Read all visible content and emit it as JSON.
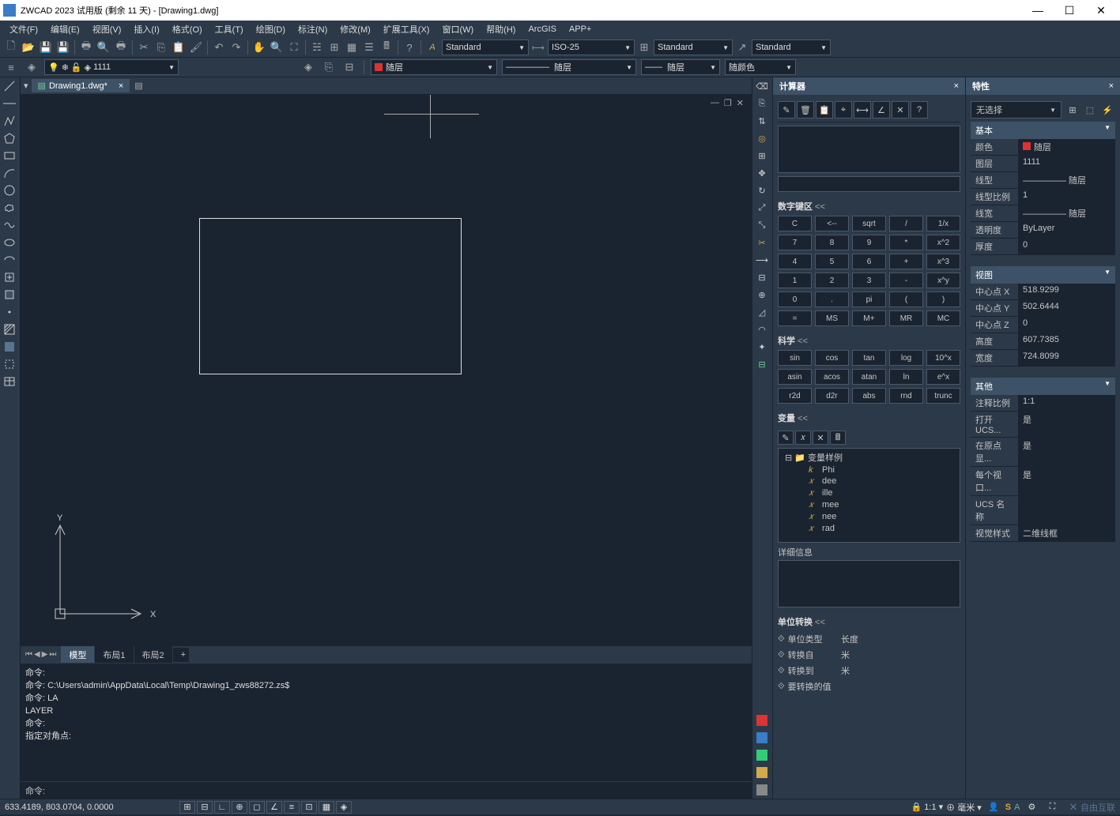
{
  "window": {
    "title": "ZWCAD 2023 试用版 (剩余 11 天) - [Drawing1.dwg]"
  },
  "menu": [
    "文件(F)",
    "编辑(E)",
    "视图(V)",
    "插入(I)",
    "格式(O)",
    "工具(T)",
    "绘图(D)",
    "标注(N)",
    "修改(M)",
    "扩展工具(X)",
    "窗口(W)",
    "帮助(H)",
    "ArcGIS",
    "APP+"
  ],
  "toolbar1": {
    "text_style": "Standard",
    "dim_style": "ISO-25",
    "table_style": "Standard",
    "mleader_style": "Standard",
    "layer_name": "1111"
  },
  "toolbar2": {
    "layer": "随层",
    "linetype": "随层",
    "lineweight": "随层",
    "color": "随颜色"
  },
  "doc_tab": "Drawing1.dwg*",
  "model_tabs": [
    "模型",
    "布局1",
    "布局2"
  ],
  "cmd_history": [
    "命令:",
    "命令: C:\\Users\\admin\\AppData\\Local\\Temp\\Drawing1_zws88272.zs$",
    "命令: LA",
    "LAYER",
    "命令:",
    "指定对角点:"
  ],
  "cmd_prompt": "命令:",
  "status": {
    "coords": "633.4189, 803.0704, 0.0000",
    "scale": "1:1",
    "unit": "毫米",
    "watermark": "自由互联"
  },
  "calc": {
    "title": "计算器",
    "numpad_h": "数字键区",
    "numpad": [
      [
        "C",
        "<--",
        "sqrt",
        "/",
        "1/x"
      ],
      [
        "7",
        "8",
        "9",
        "*",
        "x^2"
      ],
      [
        "4",
        "5",
        "6",
        "+",
        "x^3"
      ],
      [
        "1",
        "2",
        "3",
        "-",
        "x^y"
      ],
      [
        "0",
        ".",
        "pi",
        "(",
        ")"
      ],
      [
        "=",
        "MS",
        "M+",
        "MR",
        "MC"
      ]
    ],
    "sci_h": "科学",
    "sci": [
      [
        "sin",
        "cos",
        "tan",
        "log",
        "10^x"
      ],
      [
        "asin",
        "acos",
        "atan",
        "ln",
        "e^x"
      ],
      [
        "r2d",
        "d2r",
        "abs",
        "rnd",
        "trunc"
      ]
    ],
    "var_h": "变量",
    "var_root": "变量样例",
    "vars": [
      "Phi",
      "dee",
      "ille",
      "mee",
      "nee",
      "rad"
    ],
    "detail_h": "详细信息",
    "unit_h": "单位转换",
    "unit_labels": {
      "type": "单位类型",
      "from": "转换自",
      "to": "转换到",
      "val": "要转换的值"
    },
    "unit_vals": {
      "type": "长度",
      "from": "米",
      "to": "米",
      "val": ""
    }
  },
  "props": {
    "title": "特性",
    "selector": "无选择",
    "sections": {
      "basic": {
        "h": "基本",
        "rows": [
          {
            "k": "颜色",
            "v": "随层",
            "sw": true
          },
          {
            "k": "图层",
            "v": "1111"
          },
          {
            "k": "线型",
            "v": "————— 随层"
          },
          {
            "k": "线型比例",
            "v": "1"
          },
          {
            "k": "线宽",
            "v": "————— 随层"
          },
          {
            "k": "透明度",
            "v": "ByLayer"
          },
          {
            "k": "厚度",
            "v": "0"
          }
        ]
      },
      "view": {
        "h": "视图",
        "rows": [
          {
            "k": "中心点 X",
            "v": "518.9299"
          },
          {
            "k": "中心点 Y",
            "v": "502.6444"
          },
          {
            "k": "中心点 Z",
            "v": "0"
          },
          {
            "k": "高度",
            "v": "607.7385"
          },
          {
            "k": "宽度",
            "v": "724.8099"
          }
        ]
      },
      "other": {
        "h": "其他",
        "rows": [
          {
            "k": "注释比例",
            "v": "1:1"
          },
          {
            "k": "打开 UCS...",
            "v": "是"
          },
          {
            "k": "在原点显...",
            "v": "是"
          },
          {
            "k": "每个视口...",
            "v": "是"
          },
          {
            "k": "UCS 名称",
            "v": ""
          },
          {
            "k": "视觉样式",
            "v": "二维线框"
          }
        ]
      }
    }
  }
}
